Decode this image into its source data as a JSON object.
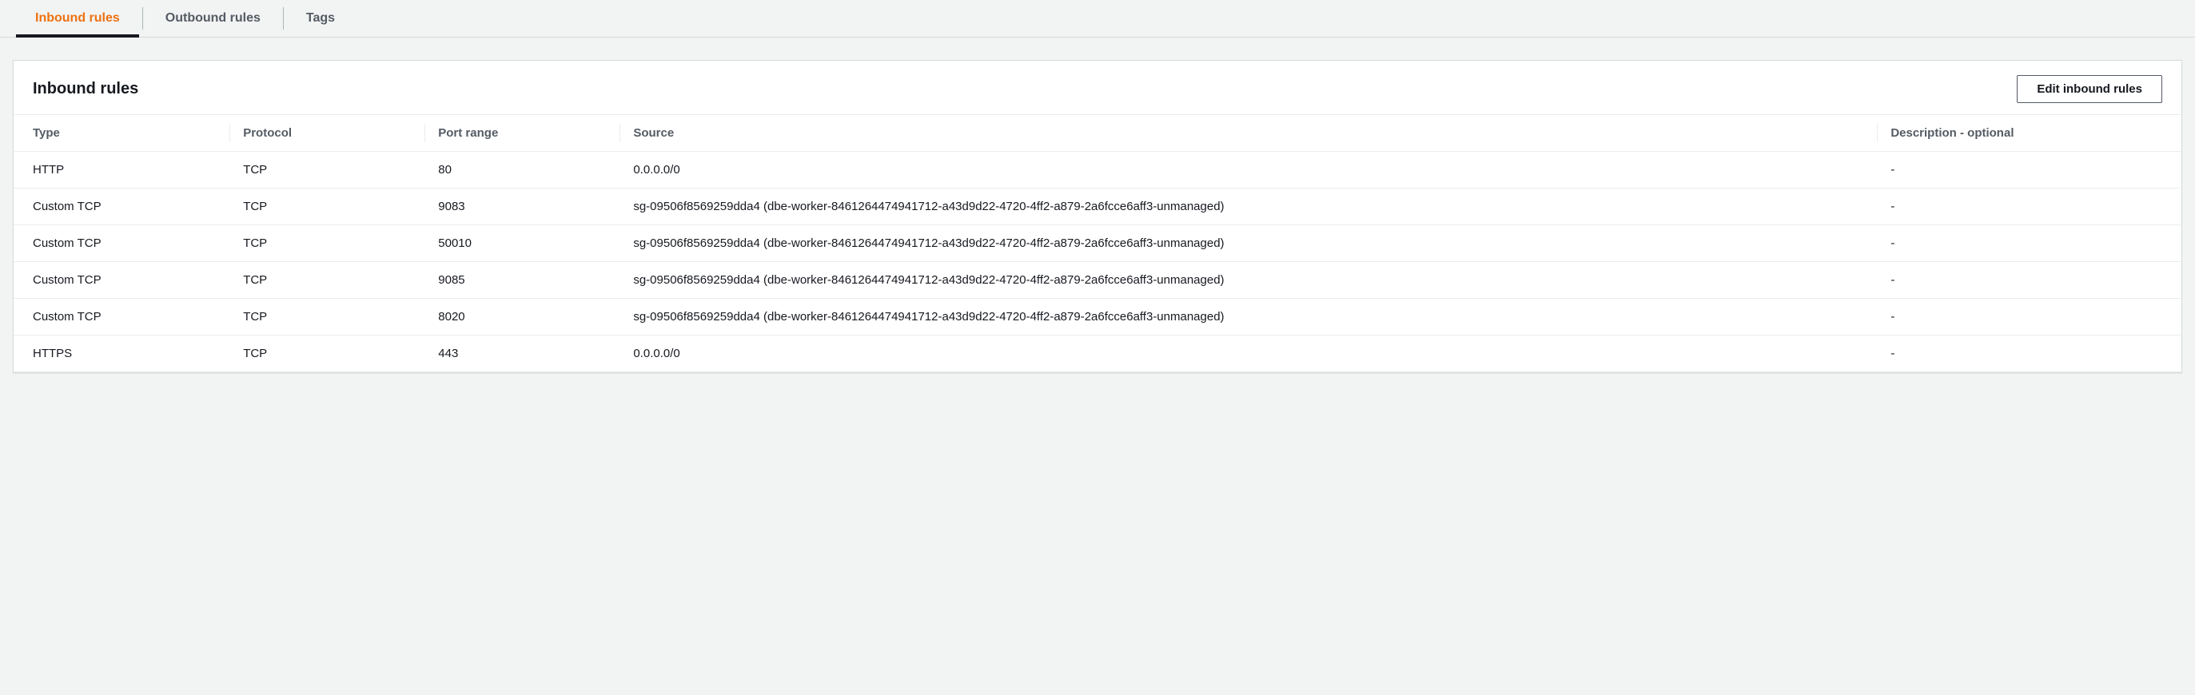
{
  "tabs": [
    {
      "label": "Inbound rules",
      "active": true
    },
    {
      "label": "Outbound rules",
      "active": false
    },
    {
      "label": "Tags",
      "active": false
    }
  ],
  "panel": {
    "title": "Inbound rules",
    "edit_button": "Edit inbound rules"
  },
  "table": {
    "headers": {
      "type": "Type",
      "protocol": "Protocol",
      "port_range": "Port range",
      "source": "Source",
      "description": "Description - optional"
    },
    "rows": [
      {
        "type": "HTTP",
        "protocol": "TCP",
        "port_range": "80",
        "source": "0.0.0.0/0",
        "description": "-"
      },
      {
        "type": "Custom TCP",
        "protocol": "TCP",
        "port_range": "9083",
        "source": "sg-09506f8569259dda4 (dbe-worker-8461264474941712-a43d9d22-4720-4ff2-a879-2a6fcce6aff3-unmanaged)",
        "description": "-"
      },
      {
        "type": "Custom TCP",
        "protocol": "TCP",
        "port_range": "50010",
        "source": "sg-09506f8569259dda4 (dbe-worker-8461264474941712-a43d9d22-4720-4ff2-a879-2a6fcce6aff3-unmanaged)",
        "description": "-"
      },
      {
        "type": "Custom TCP",
        "protocol": "TCP",
        "port_range": "9085",
        "source": "sg-09506f8569259dda4 (dbe-worker-8461264474941712-a43d9d22-4720-4ff2-a879-2a6fcce6aff3-unmanaged)",
        "description": "-"
      },
      {
        "type": "Custom TCP",
        "protocol": "TCP",
        "port_range": "8020",
        "source": "sg-09506f8569259dda4 (dbe-worker-8461264474941712-a43d9d22-4720-4ff2-a879-2a6fcce6aff3-unmanaged)",
        "description": "-"
      },
      {
        "type": "HTTPS",
        "protocol": "TCP",
        "port_range": "443",
        "source": "0.0.0.0/0",
        "description": "-"
      }
    ]
  }
}
